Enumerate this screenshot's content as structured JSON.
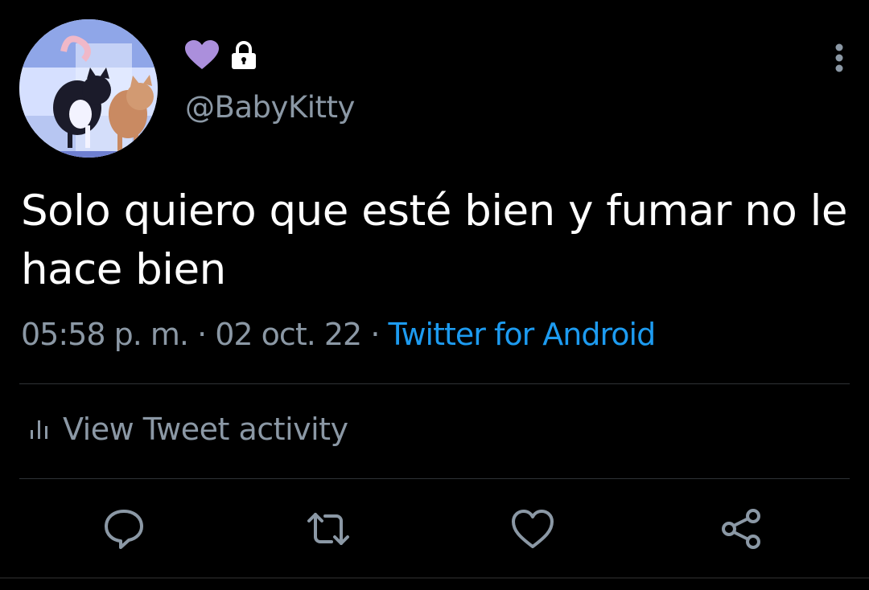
{
  "user": {
    "handle": "@BabyKitty",
    "badge_icon": "purple-heart-icon",
    "lock_icon": "lock-icon",
    "accent": "#ab8fdc"
  },
  "tweet": {
    "text": "Solo quiero que esté bien y fumar no le hace bien",
    "time": "05:58 p. m.",
    "date": "02 oct. 22",
    "separator": "·",
    "source": "Twitter for Android"
  },
  "activity": {
    "label": "View Tweet activity",
    "icon": "bar-chart-icon"
  },
  "actions": [
    {
      "name": "reply",
      "icon": "reply-icon"
    },
    {
      "name": "retweet",
      "icon": "retweet-icon"
    },
    {
      "name": "like",
      "icon": "heart-icon"
    },
    {
      "name": "share",
      "icon": "share-icon"
    }
  ],
  "colors": {
    "background": "#000000",
    "text": "#ffffff",
    "muted": "#8b98a5",
    "link": "#1d9bf0"
  }
}
